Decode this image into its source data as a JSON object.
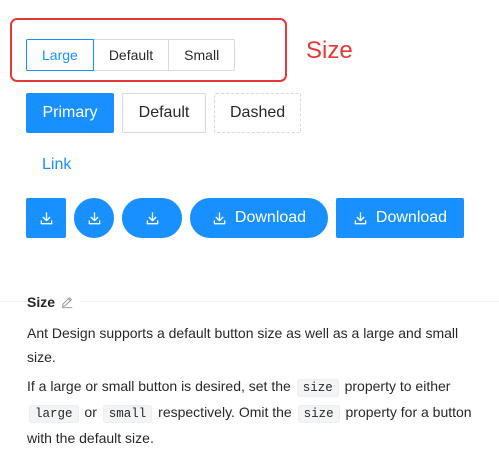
{
  "annotation": {
    "label": "Size",
    "color": "#e53935"
  },
  "size_selector": {
    "options": [
      "Large",
      "Default",
      "Small"
    ],
    "selected": "Large"
  },
  "buttons": {
    "primary": "Primary",
    "default": "Default",
    "dashed": "Dashed",
    "link": "Link",
    "download": "Download",
    "icon": "download-icon"
  },
  "colors": {
    "primary": "#1890ff"
  },
  "section": {
    "title": "Size",
    "edit_icon": "edit-icon",
    "desc1": "Ant Design supports a default button size as well as a large and small size.",
    "desc2_a": "If a large or small button is desired, set the",
    "code_size": "size",
    "desc2_b": "property to either",
    "code_large": "large",
    "desc2_or": "or",
    "code_small": "small",
    "desc2_c": "respectively. Omit the",
    "code_size2": "size",
    "desc2_d": "property for a button with the default size."
  }
}
